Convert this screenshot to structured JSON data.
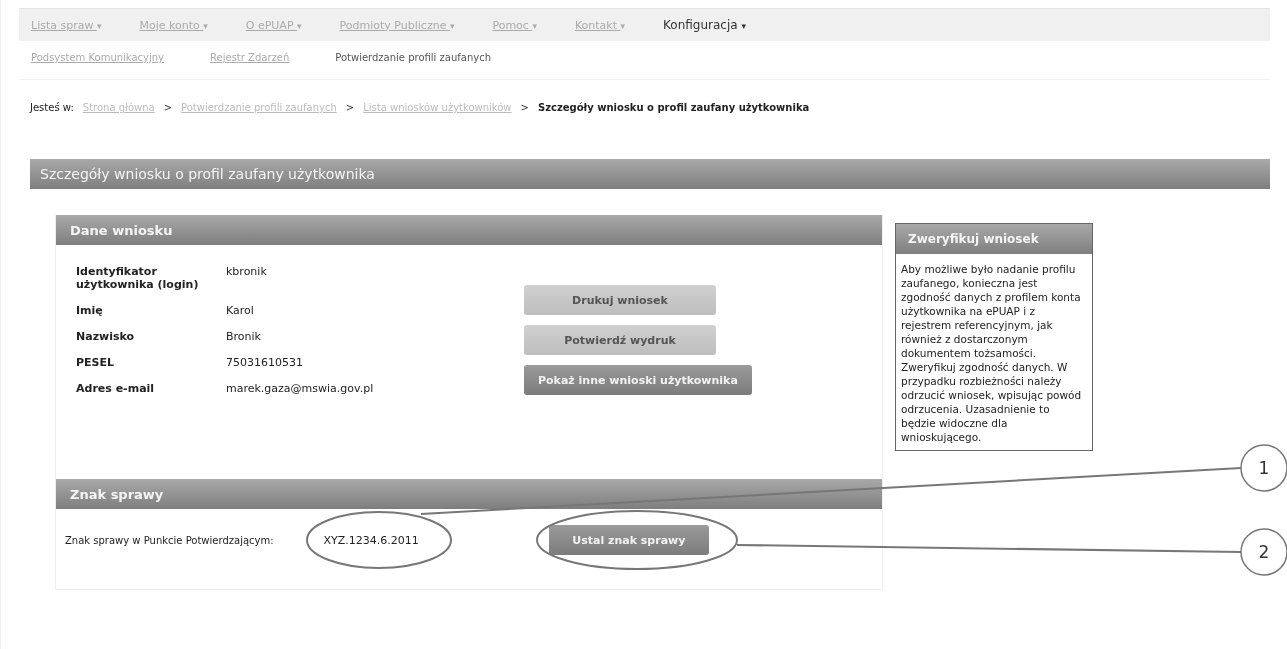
{
  "menu": [
    {
      "label": "Lista spraw",
      "caret": "▾",
      "selected": false
    },
    {
      "label": "Moje konto",
      "caret": "▾",
      "selected": false
    },
    {
      "label": "O ePUAP",
      "caret": "▾",
      "selected": false
    },
    {
      "label": "Podmioty Publiczne",
      "caret": "▾",
      "selected": false
    },
    {
      "label": "Pomoc",
      "caret": "▾",
      "selected": false
    },
    {
      "label": "Kontakt",
      "caret": "▾",
      "selected": false
    },
    {
      "label": "Konfiguracja",
      "caret": "▾",
      "selected": true
    }
  ],
  "submenu": [
    {
      "label": "Podsystem Komunikacyjny",
      "selected": false
    },
    {
      "label": "Rejestr Zdarzeń",
      "selected": false
    },
    {
      "label": "Potwierdzanie profili zaufanych",
      "selected": true
    }
  ],
  "breadcrumb": {
    "prefix": "Jesteś w:",
    "separator": ">",
    "links": [
      "Strona główna",
      "Potwierdzanie profili zaufanych",
      "Lista wniosków użytkowników"
    ],
    "current": "Szczegóły wniosku o profil zaufany użytkownika"
  },
  "page_title": "Szczegóły wniosku o profil zaufany użytkownika",
  "details": {
    "title": "Dane wniosku",
    "fields": [
      {
        "label": "Identyfikator użytkownika (login)",
        "value": "kbronik"
      },
      {
        "label": "Imię",
        "value": "Karol"
      },
      {
        "label": "Nazwisko",
        "value": "Bronik"
      },
      {
        "label": "PESEL",
        "value": "75031610531"
      },
      {
        "label": "Adres e-mail",
        "value": "marek.gaza@mswia.gov.pl"
      }
    ],
    "buttons": [
      {
        "label": "Drukuj wniosek",
        "disabled": true
      },
      {
        "label": "Potwierdź wydruk",
        "disabled": true
      },
      {
        "label": "Pokaż inne wnioski użytkownika",
        "disabled": false
      }
    ]
  },
  "verify": {
    "title": "Zweryfikuj wniosek",
    "text": "Aby możliwe było nadanie profilu zaufanego, konieczna jest zgodność danych z profilem konta użytkownika na ePUAP i z rejestrem referencyjnym, jak również z dostarczonym dokumentem tożsamości. Zweryfikuj zgodność danych. W przypadku rozbieżności należy odrzucić wniosek, wpisując powód odrzucenia. Uzasadnienie to będzie widoczne dla wnioskującego."
  },
  "case_number": {
    "title": "Znak sprawy",
    "label": "Znak sprawy w Punkcie Potwierdzającym:",
    "value": "XYZ.1234.6.2011",
    "button": "Ustal znak sprawy"
  },
  "annotations": [
    "1",
    "2"
  ]
}
